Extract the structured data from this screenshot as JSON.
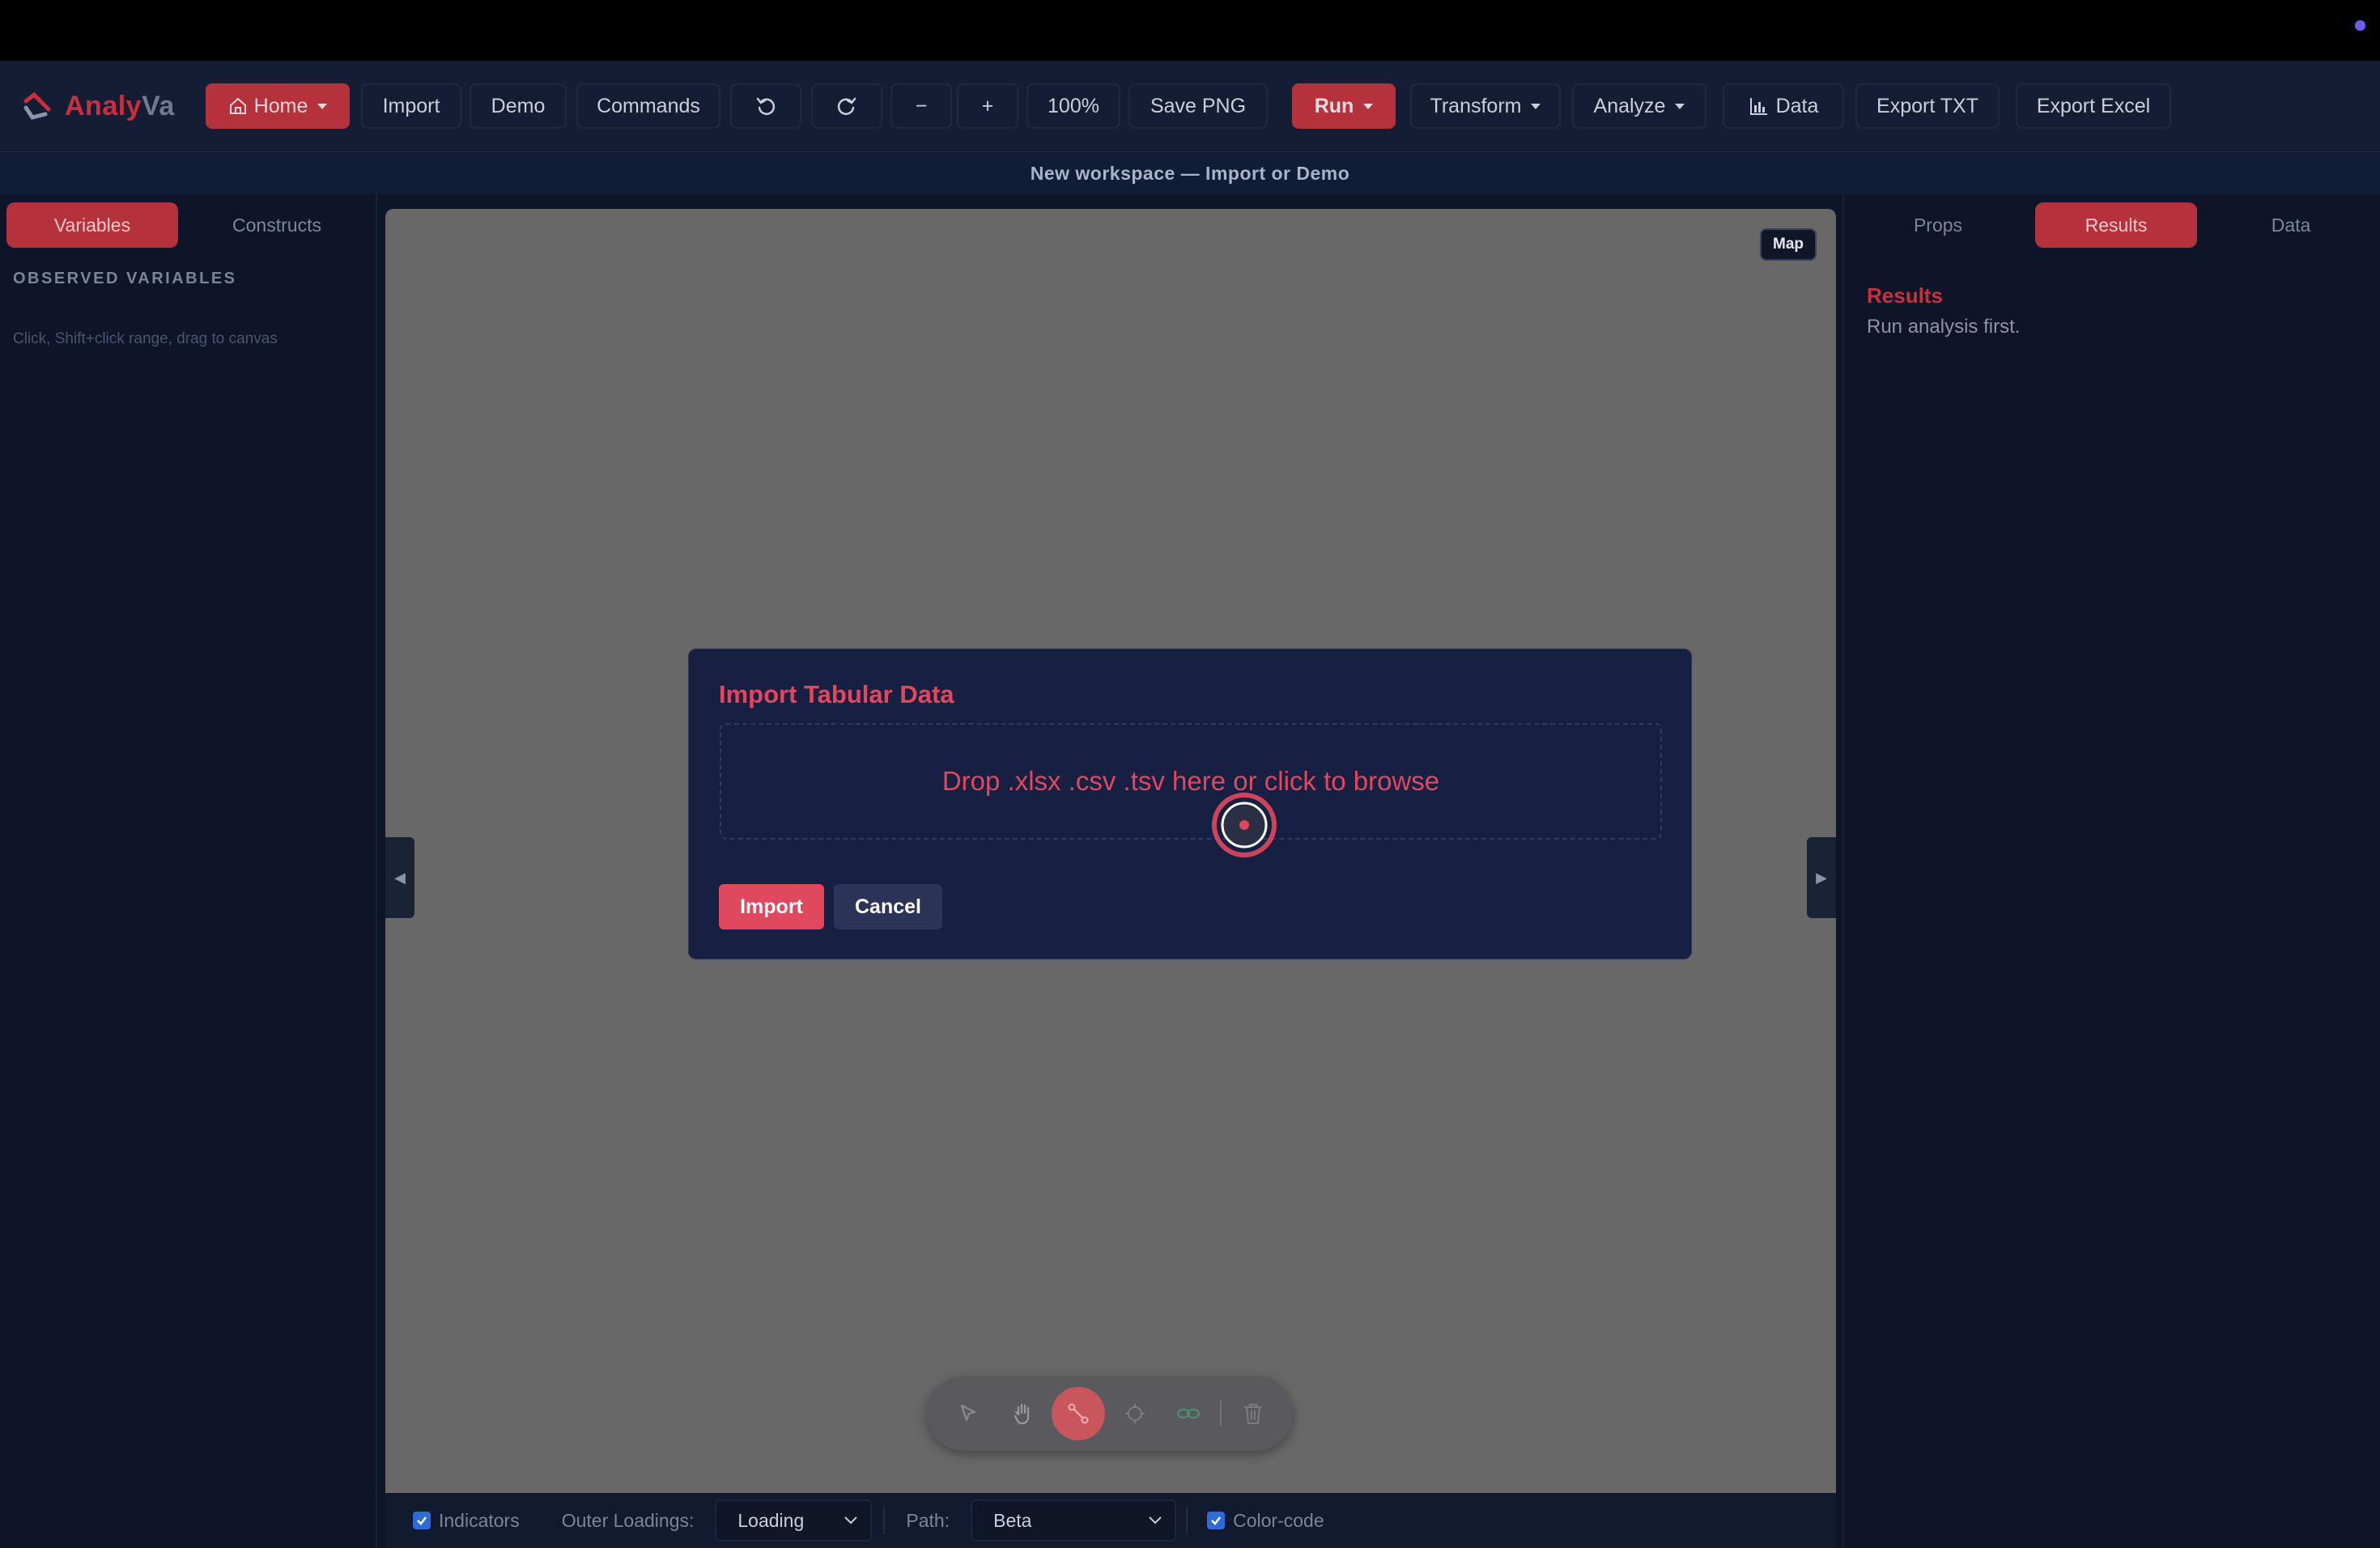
{
  "app": {
    "logo_part1": "Analy",
    "logo_part2": "Va"
  },
  "toolbar": {
    "home": "Home",
    "import": "Import",
    "demo": "Demo",
    "commands": "Commands",
    "zoom_out": "−",
    "zoom_in": "+",
    "zoom_level": "100%",
    "save_png": "Save PNG",
    "run": "Run",
    "transform": "Transform",
    "analyze": "Analyze",
    "data": "Data",
    "export_txt": "Export TXT",
    "export_excel": "Export Excel"
  },
  "banner": {
    "text": "New workspace — Import or Demo"
  },
  "left_panel": {
    "tabs": [
      "Variables",
      "Constructs"
    ],
    "active_tab": "Variables",
    "section_title": "OBSERVED VARIABLES",
    "hint": "Click, Shift+click range, drag to canvas"
  },
  "canvas": {
    "map_label": "Map",
    "left_toggle": "◀",
    "right_toggle": "▶"
  },
  "dialog": {
    "title": "Import Tabular Data",
    "dropzone_text": "Drop .xlsx .csv .tsv here or click to browse",
    "import_label": "Import",
    "cancel_label": "Cancel"
  },
  "tool_dock": {
    "tools": [
      "select-icon",
      "hand-icon",
      "connect-path-icon",
      "construct-icon",
      "link-icon",
      "trash-icon"
    ],
    "active_tool": "connect-path-icon"
  },
  "bottom_bar": {
    "indicators_label": "Indicators",
    "indicators_checked": true,
    "outer_loadings_label": "Outer Loadings:",
    "outer_loadings_value": "Loading",
    "path_label": "Path:",
    "path_value": "Beta",
    "color_code_label": "Color-code",
    "color_code_checked": true
  },
  "right_panel": {
    "tabs": [
      "Props",
      "Results",
      "Data"
    ],
    "active_tab": "Results",
    "results_title": "Results",
    "results_text": "Run analysis first."
  },
  "colors": {
    "accent": "#e0485d",
    "brand_red": "#b5323c",
    "background": "#0d1529",
    "canvas": "#686868",
    "dialog": "#172042"
  }
}
